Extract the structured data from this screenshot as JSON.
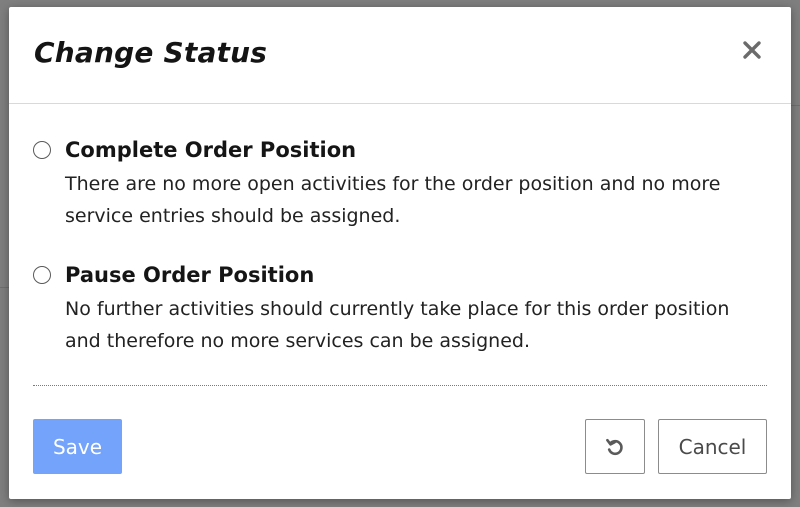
{
  "dialog": {
    "title": "Change Status",
    "close_icon": "close-icon"
  },
  "options": [
    {
      "title": "Complete Order Position",
      "description": "There are no more open activities for the order position and no more service entries should be assigned.",
      "selected": false
    },
    {
      "title": "Pause Order Position",
      "description": "No further activities should currently take place for this order position and therefore no more services can be assigned.",
      "selected": false
    }
  ],
  "footer": {
    "save_label": "Save",
    "reset_icon": "undo-icon",
    "cancel_label": "Cancel"
  },
  "colors": {
    "save_button": "#74a3fb",
    "overlay": "#7f7f7f"
  }
}
